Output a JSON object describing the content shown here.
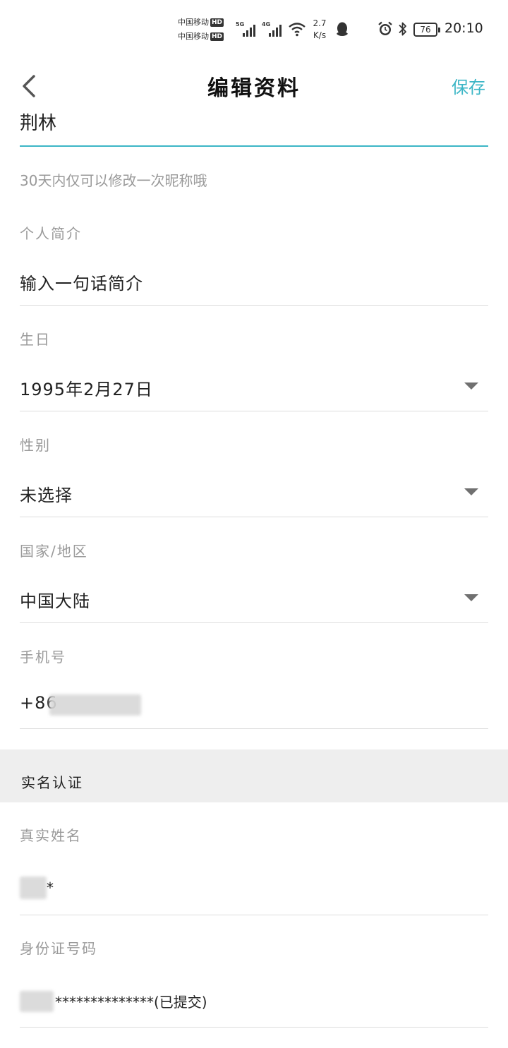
{
  "status_bar": {
    "carrier1": "中国移动",
    "carrier2": "中国移动",
    "hd": "HD",
    "net1": "5G",
    "net2": "4G",
    "speed_value": "2.7",
    "speed_unit": "K/s",
    "battery": "76",
    "time": "20:10"
  },
  "header": {
    "title": "编辑资料",
    "save_label": "保存"
  },
  "nickname": {
    "value": "荆林",
    "hint": "30天内仅可以修改一次昵称哦"
  },
  "bio": {
    "label": "个人简介",
    "placeholder": "输入一句话简介"
  },
  "birthday": {
    "label": "生日",
    "value": "1995年2月27日"
  },
  "gender": {
    "label": "性别",
    "value": "未选择"
  },
  "region": {
    "label": "国家/地区",
    "value": "中国大陆"
  },
  "phone": {
    "label": "手机号",
    "value": "+86"
  },
  "verification": {
    "section_title": "实名认证",
    "realname_label": "真实姓名",
    "realname_value": "*",
    "id_label": "身份证号码",
    "id_value": "**************(已提交)"
  },
  "colors": {
    "accent": "#3cb6c6",
    "label": "#9a9a9a",
    "divider": "#dddddd",
    "section_bg": "#eeeeee"
  }
}
